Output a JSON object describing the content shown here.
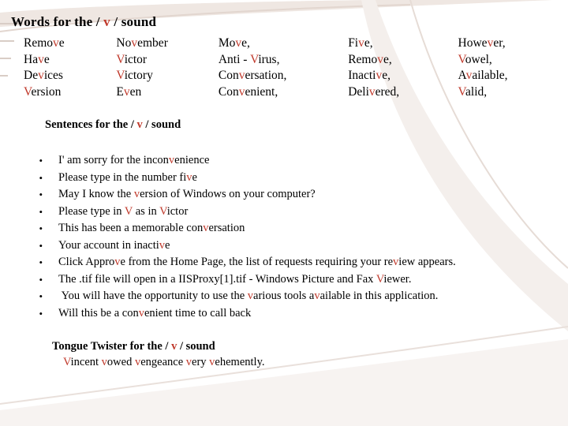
{
  "slide": {
    "title": "Words for the / v / sound",
    "sentences_heading": "Sentences for the / v / sound",
    "tongue_twister_heading": "Tongue Twister for the / v / sound",
    "tongue_twister_line": "Vincent vowed vengeance very vehemently.",
    "accent_color": "#c0392b",
    "bullet_marker": "•",
    "words": {
      "col1": [
        "Remove",
        "Have",
        "Devices",
        "Version"
      ],
      "col2": [
        "November",
        "Victor",
        "Victory",
        "Even"
      ],
      "col3": [
        "Move,",
        "Anti - Virus,",
        "Conversation,",
        "Convenient,"
      ],
      "col4": [
        "Five,",
        "Remove,",
        "Inactive,",
        "Delivered,"
      ],
      "col5": [
        "However,",
        "Vowel,",
        "Available,",
        "Valid,"
      ]
    },
    "sentences": [
      "I' am sorry for the inconvenience",
      "Please type in the number five",
      "May I know the version of Windows on your computer?",
      "Please type in V as in Victor",
      "This has been a memorable conversation",
      "Your account in inactive",
      "Click Approve from the Home Page, the list of requests requiring your review appears.",
      "The .tif file will open in a IISProxy[1].tif - Windows Picture and Fax Viewer.",
      " You will have the opportunity to use the various tools available in this application.",
      "Will this be a convenient time to call back"
    ]
  }
}
